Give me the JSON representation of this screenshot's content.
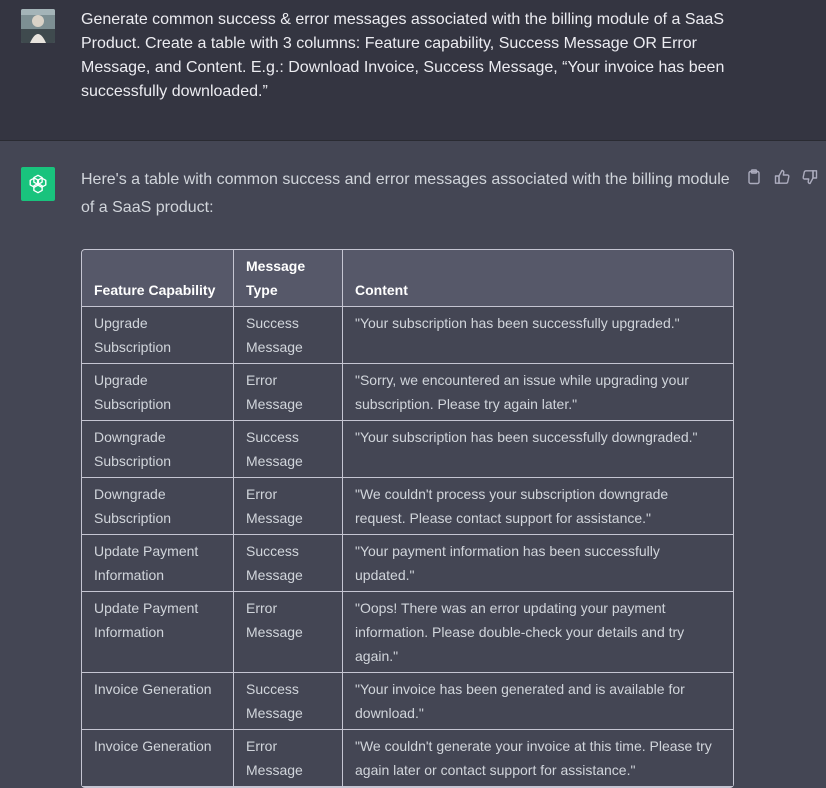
{
  "user": {
    "avatar_icon": "user-avatar-photo",
    "message": "Generate common success & error messages associated with the billing module of a SaaS Product. Create a table with 3 columns: Feature capability, Success Message OR Error Message, and Content. E.g.: Download Invoice, Success Message, “Your invoice has been successfully downloaded.”"
  },
  "assistant": {
    "avatar_icon": "openai-logo-icon",
    "intro": "Here's a table with common success and error messages associated with the billing module of a SaaS product:",
    "actions": [
      "clipboard-icon",
      "thumbs-up-icon",
      "thumbs-down-icon"
    ],
    "table": {
      "headers": [
        "Feature Capability",
        "Message Type",
        "Content"
      ],
      "rows": [
        [
          "Upgrade Subscription",
          "Success Message",
          "\"Your subscription has been successfully upgraded.\""
        ],
        [
          "Upgrade Subscription",
          "Error Message",
          "\"Sorry, we encountered an issue while upgrading your subscription. Please try again later.\""
        ],
        [
          "Downgrade Subscription",
          "Success Message",
          "\"Your subscription has been successfully downgraded.\""
        ],
        [
          "Downgrade Subscription",
          "Error Message",
          "\"We couldn't process your subscription downgrade request. Please contact support for assistance.\""
        ],
        [
          "Update Payment Information",
          "Success Message",
          "\"Your payment information has been successfully updated.\""
        ],
        [
          "Update Payment Information",
          "Error Message",
          "\"Oops! There was an error updating your payment information. Please double-check your details and try again.\""
        ],
        [
          "Invoice Generation",
          "Success Message",
          "\"Your invoice has been generated and is available for download.\""
        ],
        [
          "Invoice Generation",
          "Error Message",
          "\"We couldn't generate your invoice at this time. Please try again later or contact support for assistance.\""
        ]
      ]
    }
  },
  "colors": {
    "user_bg": "#343541",
    "assistant_bg": "#444654",
    "header_bg": "#565869",
    "brand_green": "#19c37d"
  }
}
